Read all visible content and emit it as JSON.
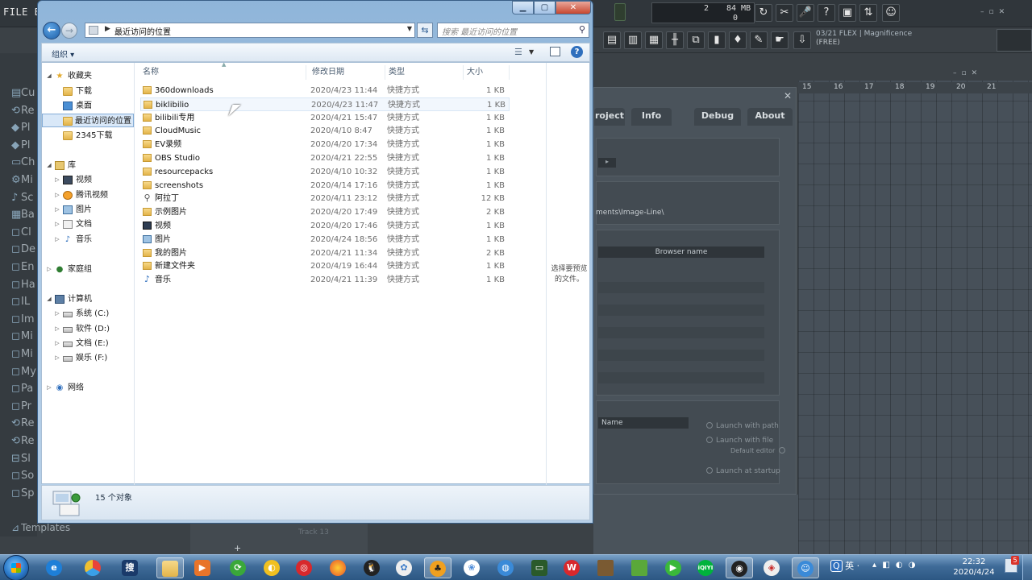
{
  "fl": {
    "menu": "FILE EDI",
    "meter_top_left": "2",
    "meter_mem": "84 MB",
    "meter_bottom": "0",
    "hint_line1": "03/21  FLEX | Magnificence",
    "hint_line2": "(FREE)",
    "browser_items": [
      "Cu",
      "Re",
      "Pl",
      "Pl",
      "Ch",
      "Mi",
      "Sc",
      "Ba",
      "Cl",
      "De",
      "En",
      "Ha",
      "IL",
      "Im",
      "Mi",
      "Mi",
      "My",
      "Pa",
      "Pr",
      "Re",
      "Re",
      "Sl",
      "So",
      "Sp"
    ],
    "templates": "Templates",
    "ruler": [
      "15",
      "16",
      "17",
      "18",
      "19",
      "20",
      "21"
    ],
    "tabs": {
      "project": "roject",
      "info": "Info",
      "debug": "Debug",
      "about": "About"
    },
    "path_text": "ments\\Image-Line\\",
    "browser_name_header": "Browser name",
    "name_header": "Name",
    "opt_launch_path": "Launch with path",
    "opt_launch_file": "Launch with file",
    "opt_default_editor": "Default editor",
    "opt_launch_startup": "Launch at startup",
    "track": "Track 13",
    "plus": "+"
  },
  "window": {
    "address": "最近访问的位置",
    "search_placeholder": "搜索 最近访问的位置",
    "organize": "组织 ▾",
    "status": "15 个对象",
    "preview": "选择要预览的文件。"
  },
  "nav": {
    "favorites": "收藏夹",
    "downloads": "下载",
    "desktop": "桌面",
    "recent": "最近访问的位置",
    "d2345": "2345下载",
    "libraries": "库",
    "videos": "视频",
    "tencent_video": "腾讯视频",
    "pictures": "图片",
    "documents": "文档",
    "music": "音乐",
    "homegroup": "家庭组",
    "computer": "计算机",
    "drive_c": "系统 (C:)",
    "drive_d": "软件 (D:)",
    "drive_e": "文档 (E:)",
    "drive_f": "娱乐 (F:)",
    "network": "网络"
  },
  "columns": {
    "name": "名称",
    "date": "修改日期",
    "type": "类型",
    "size": "大小"
  },
  "files": [
    {
      "name": "360downloads",
      "date": "2020/4/23 11:44",
      "type": "快捷方式",
      "size": "1 KB",
      "icon": "folder"
    },
    {
      "name": "biklibilio",
      "date": "2020/4/23 11:47",
      "type": "快捷方式",
      "size": "1 KB",
      "icon": "folder"
    },
    {
      "name": "bilibili专用",
      "date": "2020/4/21 15:47",
      "type": "快捷方式",
      "size": "1 KB",
      "icon": "folder"
    },
    {
      "name": "CloudMusic",
      "date": "2020/4/10 8:47",
      "type": "快捷方式",
      "size": "1 KB",
      "icon": "folder"
    },
    {
      "name": "EV录频",
      "date": "2020/4/20 17:34",
      "type": "快捷方式",
      "size": "1 KB",
      "icon": "folder"
    },
    {
      "name": "OBS Studio",
      "date": "2020/4/21 22:55",
      "type": "快捷方式",
      "size": "1 KB",
      "icon": "folder"
    },
    {
      "name": "resourcepacks",
      "date": "2020/4/10 10:32",
      "type": "快捷方式",
      "size": "1 KB",
      "icon": "folder"
    },
    {
      "name": "screenshots",
      "date": "2020/4/14 17:16",
      "type": "快捷方式",
      "size": "1 KB",
      "icon": "folder"
    },
    {
      "name": "阿拉丁",
      "date": "2020/4/11 23:12",
      "type": "快捷方式",
      "size": "12 KB",
      "icon": "search"
    },
    {
      "name": "示例图片",
      "date": "2020/4/20 17:49",
      "type": "快捷方式",
      "size": "2 KB",
      "icon": "folder"
    },
    {
      "name": "视频",
      "date": "2020/4/20 17:46",
      "type": "快捷方式",
      "size": "1 KB",
      "icon": "video"
    },
    {
      "name": "图片",
      "date": "2020/4/24 18:56",
      "type": "快捷方式",
      "size": "1 KB",
      "icon": "pic"
    },
    {
      "name": "我的图片",
      "date": "2020/4/21 11:34",
      "type": "快捷方式",
      "size": "2 KB",
      "icon": "folder"
    },
    {
      "name": "新建文件夹",
      "date": "2020/4/19 16:44",
      "type": "快捷方式",
      "size": "1 KB",
      "icon": "folder"
    },
    {
      "name": "音乐",
      "date": "2020/4/21 11:39",
      "type": "快捷方式",
      "size": "1 KB",
      "icon": "music"
    }
  ],
  "taskbar": {
    "search_glyph": "搜",
    "iqiyi": "iQIYI",
    "ime": "英",
    "clock_time": "22:32",
    "clock_date": "2020/4/24",
    "notify_count": "5"
  }
}
